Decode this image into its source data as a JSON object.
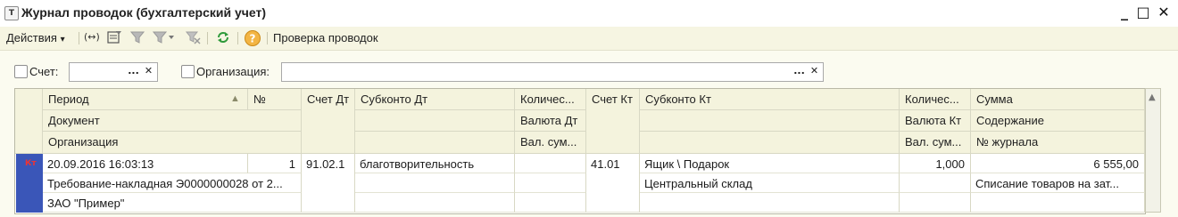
{
  "window": {
    "title": "Журнал проводок (бухгалтерский учет)",
    "app_icon_glyph": "Т",
    "minimize_glyph": "_",
    "maximize_glyph": "□",
    "close_glyph": "✕"
  },
  "toolbar": {
    "actions_label": "Действия",
    "actions_arrow": "▾",
    "check_postings_label": "Проверка проводок",
    "icons": [
      "expand-icon",
      "filter-settings-icon",
      "filter-icon",
      "filter-dropdown-icon",
      "clear-filter-icon",
      "refresh-icon",
      "help-icon"
    ]
  },
  "filters": {
    "account_label": "Счет:",
    "account_value": "",
    "organization_label": "Организация:",
    "organization_value": "",
    "select_glyph": "...",
    "clear_glyph": "✕"
  },
  "table": {
    "headers": {
      "period": "Период",
      "number": "№",
      "document": "Документ",
      "organization": "Организация",
      "account_dt": "Счет Дт",
      "subconto_dt": "Субконто Дт",
      "quantity_dt": "Количес...",
      "currency_dt": "Валюта Дт",
      "currency_sum_dt": "Вал. сум...",
      "account_kt": "Счет Кт",
      "subconto_kt": "Субконто Кт",
      "quantity_kt": "Количес...",
      "currency_kt": "Валюта Кт",
      "currency_sum_kt": "Вал. сум...",
      "sum": "Сумма",
      "content": "Содержание",
      "journal_no": "№ журнала"
    },
    "rows": [
      {
        "marker": "Кт",
        "period": "20.09.2016 16:03:13",
        "number": "1",
        "document": "Требование-накладная Э0000000028 от 2...",
        "organization": "ЗАО \"Пример\"",
        "account_dt": "91.02.1",
        "subconto_dt": "благотворительность",
        "account_kt": "41.01",
        "subconto_kt_1": "Ящик \\ Подарок",
        "subconto_kt_2": "Центральный склад",
        "quantity_kt": "1,000",
        "sum": "6 555,00",
        "content": "Списание товаров на зат..."
      }
    ]
  },
  "colors": {
    "header_bg": "#f4f3dd",
    "toolbar_bg": "#f6f5e2",
    "selection_marker": "#3a56b8",
    "refresh_icon": "#2e9a3a",
    "help_icon": "#e89b1c"
  }
}
